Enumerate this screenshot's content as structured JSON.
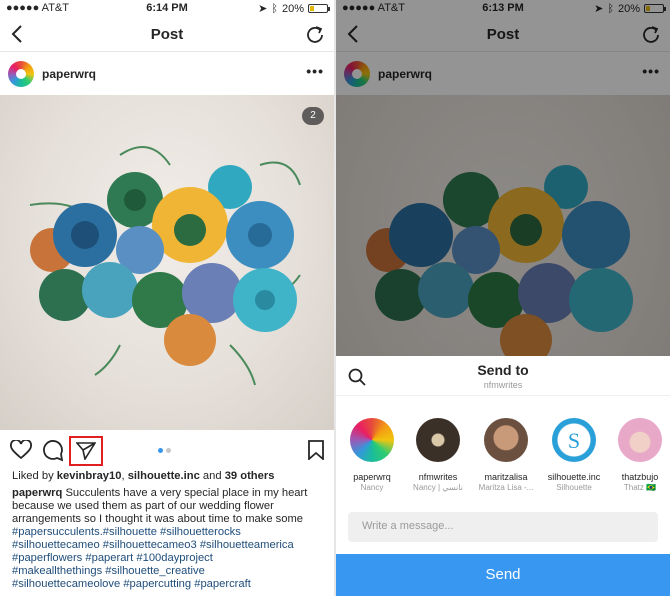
{
  "left": {
    "status": {
      "carrier": "●●●●● AT&T",
      "time": "6:14 PM",
      "battery": "20%"
    },
    "nav": {
      "title": "Post"
    },
    "post": {
      "username": "paperwrq",
      "more": "•••",
      "image_count_badge": "2",
      "carousel_position": 1,
      "carousel_total": 2,
      "likes_prefix": "Liked by ",
      "liked_user": "kevinbray10",
      "liked_sep": ", ",
      "liked_user2": "silhouette.inc",
      "likes_and": " and ",
      "likes_others": "39 others",
      "caption_user": "paperwrq",
      "caption_text": " Succulents have a very special place in my heart because we used them as part of our wedding flower arrangements so I thought it was about time to make some",
      "hashtags": [
        "#papersucculents.#silhouette #silhouetterocks",
        "#silhouettecameo #silhouettecameo3 #silhouetteamerica",
        "#paperflowers #paperart #100dayproject",
        "#makeallthethings #silhouette_creative",
        "#silhouettecameolove #papercutting #papercraft"
      ]
    }
  },
  "right": {
    "status": {
      "carrier": "●●●●● AT&T",
      "time": "6:13 PM",
      "battery": "20%"
    },
    "nav": {
      "title": "Post"
    },
    "post": {
      "username": "paperwrq",
      "more": "•••"
    },
    "sheet": {
      "title": "Send to",
      "subtitle": "nfmwrites",
      "recipients": [
        {
          "name": "paperwrq",
          "sub": "Nancy"
        },
        {
          "name": "nfmwrites",
          "sub": "Nancy | نانسي"
        },
        {
          "name": "maritzalisa",
          "sub": "Maritza Lisa -..."
        },
        {
          "name": "silhouette.inc",
          "sub": "Silhouette"
        },
        {
          "name": "thatzbujo",
          "sub": "Thatz 🇧🇷"
        }
      ],
      "message_placeholder": "Write a message...",
      "send_label": "Send"
    }
  },
  "colors": {
    "accent": "#3897f0",
    "highlight": "#e02020",
    "hashtag": "#1f4d7a"
  }
}
